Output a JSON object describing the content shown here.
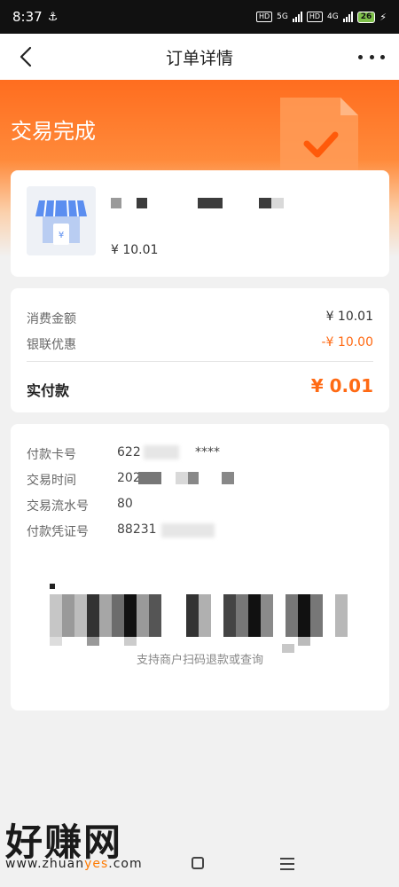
{
  "status_bar": {
    "time": "8:37",
    "network_labels": [
      "HD",
      "5G",
      "HD",
      "4G"
    ],
    "battery": "26"
  },
  "nav": {
    "title": "订单详情",
    "back_icon": "chevron-left-icon",
    "more_icon": "more-dots-icon"
  },
  "header": {
    "status_text": "交易完成",
    "accent": "#ff6d1f"
  },
  "merchant": {
    "icon": "store-icon",
    "amount": "¥ 10.01"
  },
  "amounts": {
    "consume_label": "消费金额",
    "consume_value": "¥ 10.01",
    "discount_label": "银联优惠",
    "discount_value": "-¥ 10.00",
    "paid_label": "实付款",
    "paid_value": "¥ 0.01",
    "highlight": "#ff6a14"
  },
  "details": [
    {
      "label": "付款卡号",
      "value": "622"
    },
    {
      "label": "交易时间",
      "value": "202"
    },
    {
      "label": "交易流水号",
      "value": "80"
    },
    {
      "label": "付款凭证号",
      "value": "88231"
    }
  ],
  "card_mask_suffix": "****",
  "barcode_caption": "支持商户扫码退款或查询",
  "watermark": {
    "logo_text": "好赚网",
    "url_prefix": "www.zhuan",
    "url_highlight": "yes",
    "url_suffix": ".com"
  }
}
